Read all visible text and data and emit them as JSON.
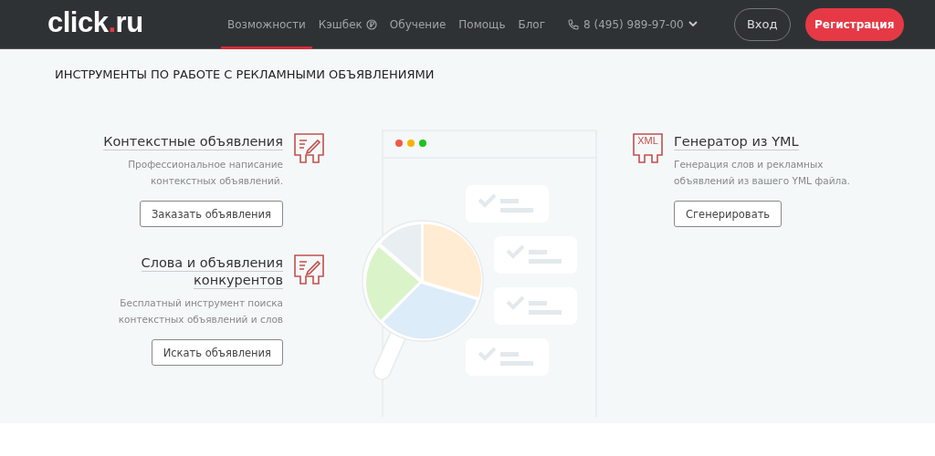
{
  "header": {
    "logo": {
      "name": "click",
      "dot": ".",
      "tld": "ru"
    },
    "nav": [
      {
        "label": "Возможности",
        "selected": true
      },
      {
        "label": "Кэшбек",
        "selected": false,
        "kind": "cashback"
      },
      {
        "label": "Обучение",
        "selected": false
      },
      {
        "label": "Помощь",
        "selected": false
      },
      {
        "label": "Блог",
        "selected": false
      }
    ],
    "phone": "8 (495) 989-97-00",
    "login": "Вход",
    "register": "Регистрация"
  },
  "section": {
    "title": "ИНСТРУМЕНТЫ ПО РАБОТЕ С РЕКЛАМНЫМИ ОБЪЯВЛЕНИЯМИ",
    "left_tools": [
      {
        "title": "Контекстные объявления",
        "description": [
          "Профессиональное написание",
          "контекстных объявлений."
        ],
        "button": "Заказать объявления",
        "kind": "edit"
      },
      {
        "title": [
          "Слова и объявления",
          "конкурентов"
        ],
        "description": [
          "Бесплатный инструмент поиска",
          "контекстных объявлений и слов"
        ],
        "button": "Искать объявления",
        "kind": "edit"
      }
    ],
    "right_tools": [
      {
        "title": "Генератор из YML",
        "description": [
          "Генерация слов и рекламных",
          "объявлений из вашего YML файла."
        ],
        "button": "Сгенерировать",
        "kind": "xml",
        "icon_text": "XML"
      }
    ]
  }
}
